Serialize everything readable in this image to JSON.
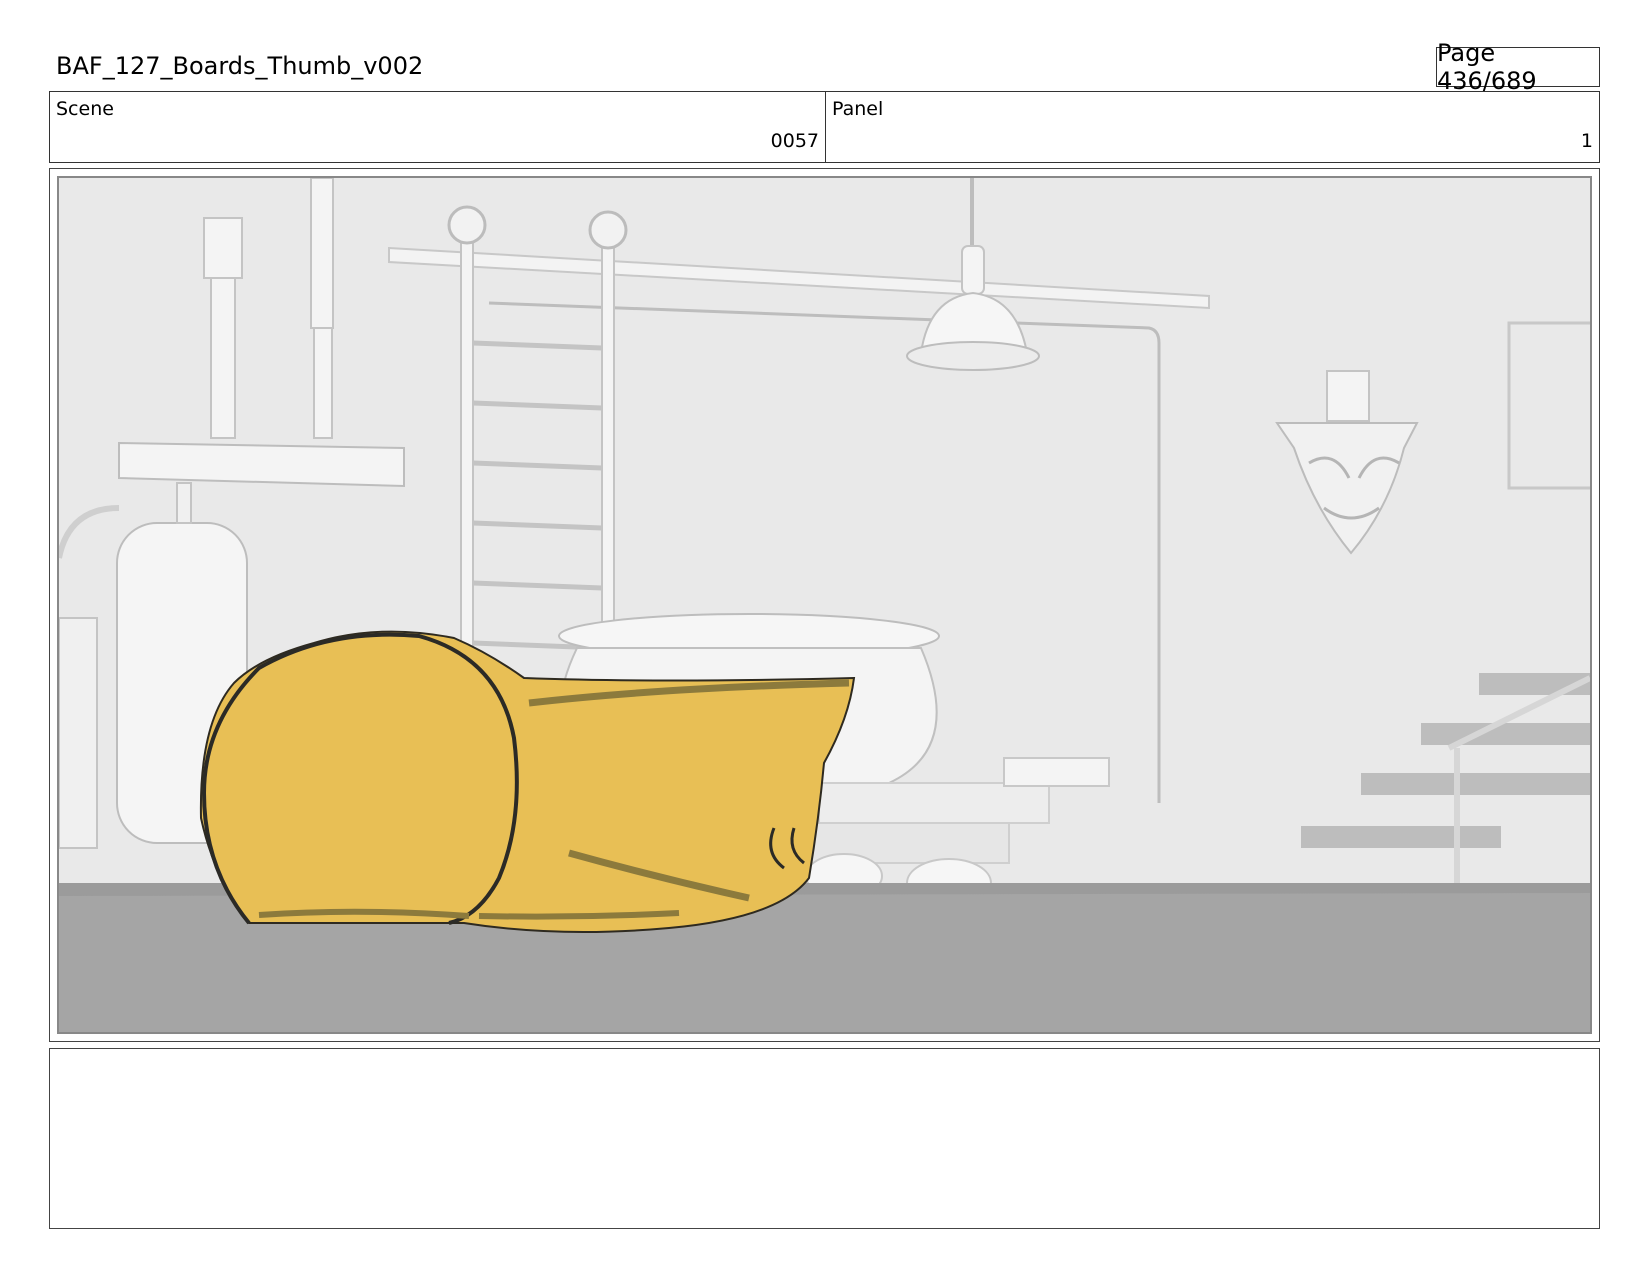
{
  "header": {
    "title": "BAF_127_Boards_Thumb_v002",
    "page_label": "Page 436/689"
  },
  "info": {
    "scene_label": "Scene",
    "scene_value": "0057",
    "panel_label": "Panel",
    "panel_value": "1"
  },
  "notes": {
    "text": ""
  },
  "colors": {
    "wall": "#e9e9e9",
    "floor": "#a5a5a5",
    "props": "#f4f4f4",
    "character": "#e8bf55"
  }
}
